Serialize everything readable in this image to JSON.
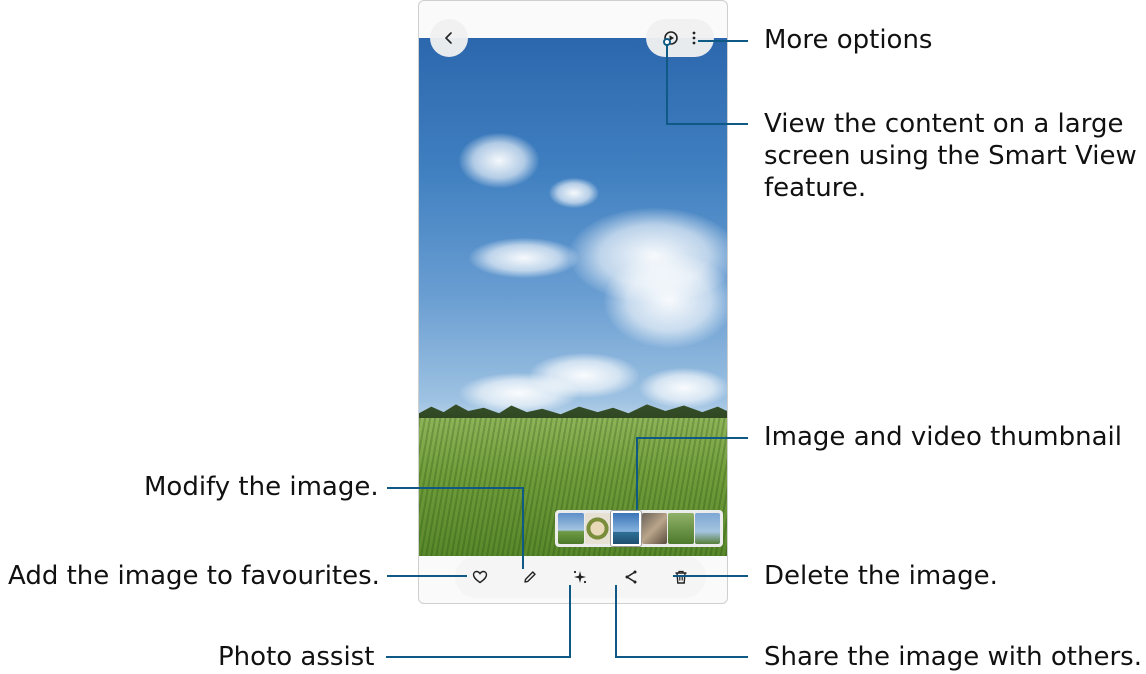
{
  "callouts": {
    "more_options": "More options",
    "smart_view": "View the content on a large screen using the Smart View feature.",
    "thumbnails": "Image and video thumbnail",
    "modify": "Modify the image.",
    "favourites": "Add the image to favourites.",
    "delete": "Delete the image.",
    "photo_assist": "Photo assist",
    "share": "Share the image with others."
  },
  "icons": {
    "back": "chevron-left-icon",
    "smart_view": "smart-view-icon",
    "more": "more-options-icon",
    "favourite": "heart-icon",
    "edit": "pencil-icon",
    "assist": "sparkle-icon",
    "share": "share-icon",
    "delete": "trash-icon"
  },
  "colors": {
    "callout_line": "#0f5a85",
    "bar_background": "#f5f5f5"
  }
}
